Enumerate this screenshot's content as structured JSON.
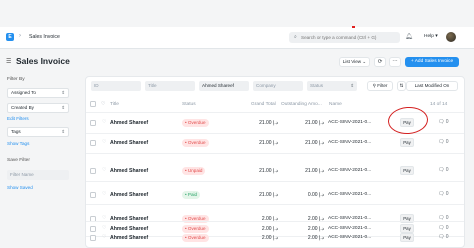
{
  "header": {
    "breadcrumb": "Sales Invoice",
    "search_placeholder": "Search or type a command (Ctrl + G)",
    "help_label": "Help ▾"
  },
  "page": {
    "title": "Sales Invoice",
    "list_view_label": "List View ⌄",
    "refresh_icon": "⟳",
    "more_icon": "···",
    "add_button_label": "+ Add Sales Invoice"
  },
  "sidebar": {
    "filter_by_label": "Filter By",
    "assigned_to": "Assigned To",
    "created_by": "Created By",
    "edit_filters": "Edit Filters",
    "tags": "Tags",
    "show_tags": "Show Tags",
    "save_filter_label": "Save Filter",
    "filter_name_placeholder": "Filter Name",
    "show_saved": "Show Saved"
  },
  "filters": {
    "id_placeholder": "ID",
    "title_placeholder": "Title",
    "customer_value": "Ahmed Shareef",
    "company_placeholder": "Company",
    "status_placeholder": "Status",
    "filter_button": "Filter",
    "sort_button": "Last Modified On"
  },
  "columns": {
    "title": "Title",
    "status": "Status",
    "grand_total": "Grand Total",
    "outstanding": "Outstanding Amo...",
    "name": "Name",
    "count": "14 of 14"
  },
  "rows": [
    {
      "title": "Ahmed Shareef",
      "status": "Overdue",
      "status_color": "red",
      "grand_total": "21.00 د.إ",
      "outstanding": "21.00 د.إ",
      "name": "ACC-SINV-2021-0...",
      "action": "Pay",
      "comments": "0"
    },
    {
      "title": "Ahmed Shareef",
      "status": "Overdue",
      "status_color": "red",
      "grand_total": "21.00 د.إ",
      "outstanding": "21.00 د.إ",
      "name": "ACC-SINV-2021-0...",
      "action": "Pay",
      "comments": "0"
    },
    {
      "title": "Ahmed Shareef",
      "status": "Unpaid",
      "status_color": "red",
      "grand_total": "21.00 د.إ",
      "outstanding": "21.00 د.إ",
      "name": "ACC-SINV-2021-0...",
      "action": "Pay",
      "comments": "0"
    },
    {
      "title": "Ahmed Shareef",
      "status": "Paid",
      "status_color": "green",
      "grand_total": "21.00 د.إ",
      "outstanding": "0.00 د.إ",
      "name": "ACC-SINV-2021-0...",
      "action": "",
      "comments": "0"
    },
    {
      "title": "Ahmed Shareef",
      "status": "Overdue",
      "status_color": "red",
      "grand_total": "2.00 د.إ",
      "outstanding": "2.00 د.إ",
      "name": "ACC-SINV-2021-0...",
      "action": "Pay",
      "comments": "0"
    },
    {
      "title": "Ahmed Shareef",
      "status": "Overdue",
      "status_color": "red",
      "grand_total": "2.00 د.إ",
      "outstanding": "2.00 د.إ",
      "name": "ACC-SINV-2021-0...",
      "action": "Pay",
      "comments": "0"
    },
    {
      "title": "Ahmed Shareef",
      "status": "Overdue",
      "status_color": "red",
      "grand_total": "2.00 د.إ",
      "outstanding": "2.00 د.إ",
      "name": "ACC-SINV-2021-0...",
      "action": "Pay",
      "comments": "0"
    }
  ],
  "colors": {
    "accent": "#2490ef",
    "overdue_bg": "#ffe4e4",
    "overdue_text": "#e24c4c",
    "paid_bg": "#e4f5e9",
    "paid_text": "#30a66d",
    "annotation": "#d42020"
  }
}
